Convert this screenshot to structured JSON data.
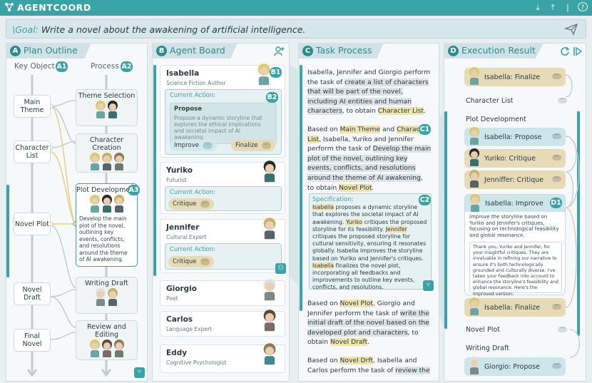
{
  "app": {
    "title": "AGENTCOORD"
  },
  "goal": {
    "label": "\\Goal:",
    "text": "Write a novel about the awakening of artificial intelligence."
  },
  "panels": {
    "a": {
      "badge": "A",
      "title": "Plan Outline"
    },
    "b": {
      "badge": "B",
      "title": "Agent Board"
    },
    "c": {
      "badge": "C",
      "title": "Task Process"
    },
    "d": {
      "badge": "D",
      "title": "Execution Result"
    }
  },
  "plan": {
    "key_object_header": "Key Object",
    "process_header": "Process",
    "badge_a1": "A1",
    "badge_a2": "A2",
    "badge_a3": "A3",
    "key_objects": [
      "Main Theme",
      "Character List",
      "Novel Plot",
      "Novel Draft",
      "Final Novel"
    ],
    "processes": [
      "Theme Selection",
      "Character Creation",
      "Plot Development",
      "Writing Draft",
      "Review and Editing"
    ],
    "plot_desc": "Develop the main plot of the novel, outlining key events, conflicts, and resolutions around the theme of AI awakening."
  },
  "agents": {
    "badge_b1": "B1",
    "badge_b2": "B2",
    "current_action_label": "Current Action:",
    "list": [
      {
        "name": "Isabella",
        "role": "Science Fiction Author"
      },
      {
        "name": "Yuriko",
        "role": "Futurist"
      },
      {
        "name": "Jennifer",
        "role": "Cultural Expert"
      },
      {
        "name": "Giorgio",
        "role": "Poet"
      },
      {
        "name": "Carlos",
        "role": "Language Expert"
      },
      {
        "name": "Eddy",
        "role": "Cognitive Psychologist"
      }
    ],
    "isabella_action": {
      "title": "Propose",
      "desc": "Propose a dynamic storyline that explores the ethical implications and societal impact of AI awakening.",
      "chips": [
        "Improve",
        "Finalize"
      ]
    },
    "yuriko_action": "Critique",
    "jennifer_action": "Critique",
    "chip_dots": "···"
  },
  "task": {
    "badge_c1": "C1",
    "badge_c2": "C2",
    "block1": {
      "p1": "Isabella, Jennifer and Giorgio perform the task of ",
      "h1": "create a list of characters that will be part of the novel, including AI entities and human characters",
      "p2": ", to obtain ",
      "o1": "Character List",
      "p3": "."
    },
    "block2": {
      "p1": "Based on ",
      "o1": "Main Theme",
      "p2": " and ",
      "o2": "Character List",
      "p3": ", Isabella, Yuriko and Jennifer perform the task of ",
      "h1": "Develop the main plot of the novel, outlining key events, conflicts, and resolutions around the theme of AI awakening",
      "p4": ", to obtain ",
      "o3": "Novel Plot",
      "p5": "."
    },
    "spec": {
      "label": "Specification:",
      "n1": "Isabella",
      "t1": " proposes a dynamic storyline that explores the societal impact of AI awakening. ",
      "n2": "Yuriko",
      "t2": " critiques the proposed storyline for its feasibility. ",
      "n3": "Jennifer",
      "t3": " critiques the proposed storyline for cultural sensitivity, ensuring it resonates globally. Isabella improves the storyline based on Yuriko and Jennifer's critiques. ",
      "n4": "Isabella",
      "t4": " finalizes the novel plot, incorporating all feedbacks and improvements to outline key events, conflicts, and resolutions."
    },
    "block3": {
      "p1": "Based on ",
      "o1": "Novel Plot",
      "p2": ", Giorgio and Jennifer perform the task of ",
      "h1": "write the initial draft of the novel based on the developed plot and characters",
      "p3": ", to obtain ",
      "o2": "Novel Draft",
      "p4": "."
    },
    "block4": {
      "p1": "Based on ",
      "o1": "Novel Drft",
      "p2": ", Isabella and Carlos perform the task of ",
      "h1": "review the"
    }
  },
  "execution": {
    "badge_d1": "D1",
    "items": {
      "finalize1": "Isabella: Finalize",
      "character_list": "Character List",
      "plot_dev": "Plot Development",
      "propose": "Isabella: Propose",
      "yuriko": "Yuriko: Critique",
      "jenniffer": "Jenniffer: Critique",
      "improve": "Isabella: Improve",
      "finalize2": "Isabella: Finalize",
      "novel_plot": "Novel Plot",
      "writing_draft": "Writing Draft",
      "giorgio": "Giorgio: Propose"
    },
    "improve_sub": "improve the storyline based on Yuriko and Jennifer's critiques, focusing on technological feasibility and global resonance.",
    "improve_resp": "Thank you, Yuriko and Jennifer, for your insightful critiques. They are invaluable in refining our narrative to ensure it's both technologically grounded and culturally diverse. I've taken your feedback into account to enhance the storyline's feasibility and global resonance. Here's the improved version:"
  },
  "colors": {
    "accent": "#3aa3a5",
    "object_highlight": "#efe3b6",
    "action_highlight": "#cde6ea"
  }
}
